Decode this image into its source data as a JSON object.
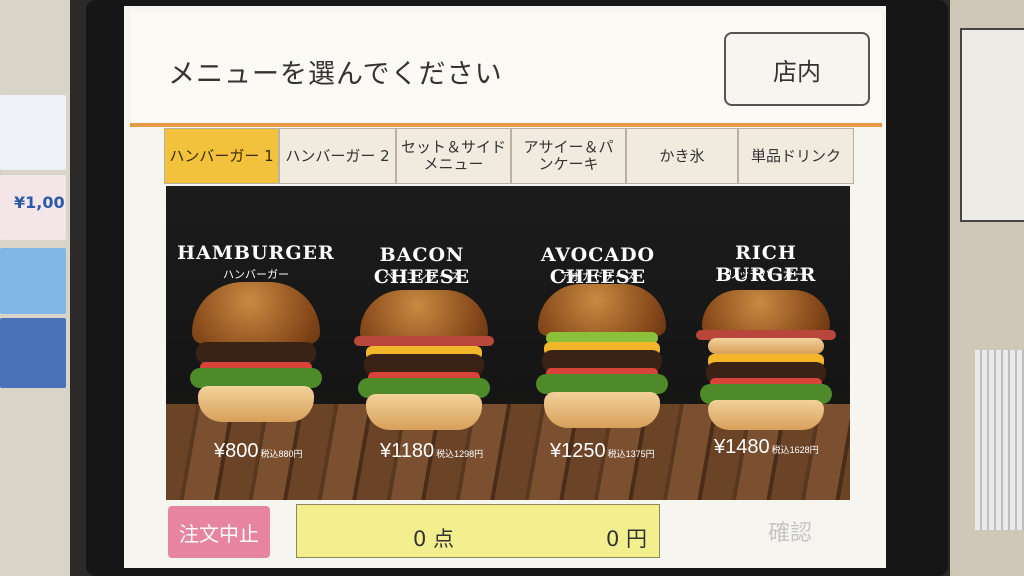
{
  "header": {
    "title": "メニューを選んでください",
    "dine_in": "店内"
  },
  "tabs": [
    {
      "label": "ハンバーガー 1",
      "active": true
    },
    {
      "label": "ハンバーガー 2",
      "active": false
    },
    {
      "label": "セット＆サイドメニュー",
      "active": false
    },
    {
      "label": "アサイー＆パンケーキ",
      "active": false
    },
    {
      "label": "かき氷",
      "active": false
    },
    {
      "label": "単品ドリンク",
      "active": false
    }
  ],
  "menu": [
    {
      "name_en": "HAMBURGER",
      "name_jp": "ハンバーガー",
      "price": "¥800",
      "tax_note": "税込880円"
    },
    {
      "name_en": "BACON CHEESE",
      "name_jp": "ベーコンチーズ",
      "price": "¥1180",
      "tax_note": "税込1298円"
    },
    {
      "name_en": "AVOCADO CHEESE",
      "name_jp": "アボカドチーズ",
      "price": "¥1250",
      "tax_note": "税込1375円"
    },
    {
      "name_en": "RICH BURGER",
      "name_jp": "リッチバーガー",
      "price": "¥1480",
      "tax_note": "税込1628円"
    }
  ],
  "footer": {
    "cancel": "注文中止",
    "count": "0 点",
    "amount": "0 円",
    "confirm": "確認"
  },
  "colors": {
    "accent": "#e49a47",
    "active_tab": "#f2c23c",
    "cancel": "#e784a0",
    "total_bg": "#f3ef8e"
  },
  "side_flyer": {
    "price_text": "¥1,00"
  }
}
